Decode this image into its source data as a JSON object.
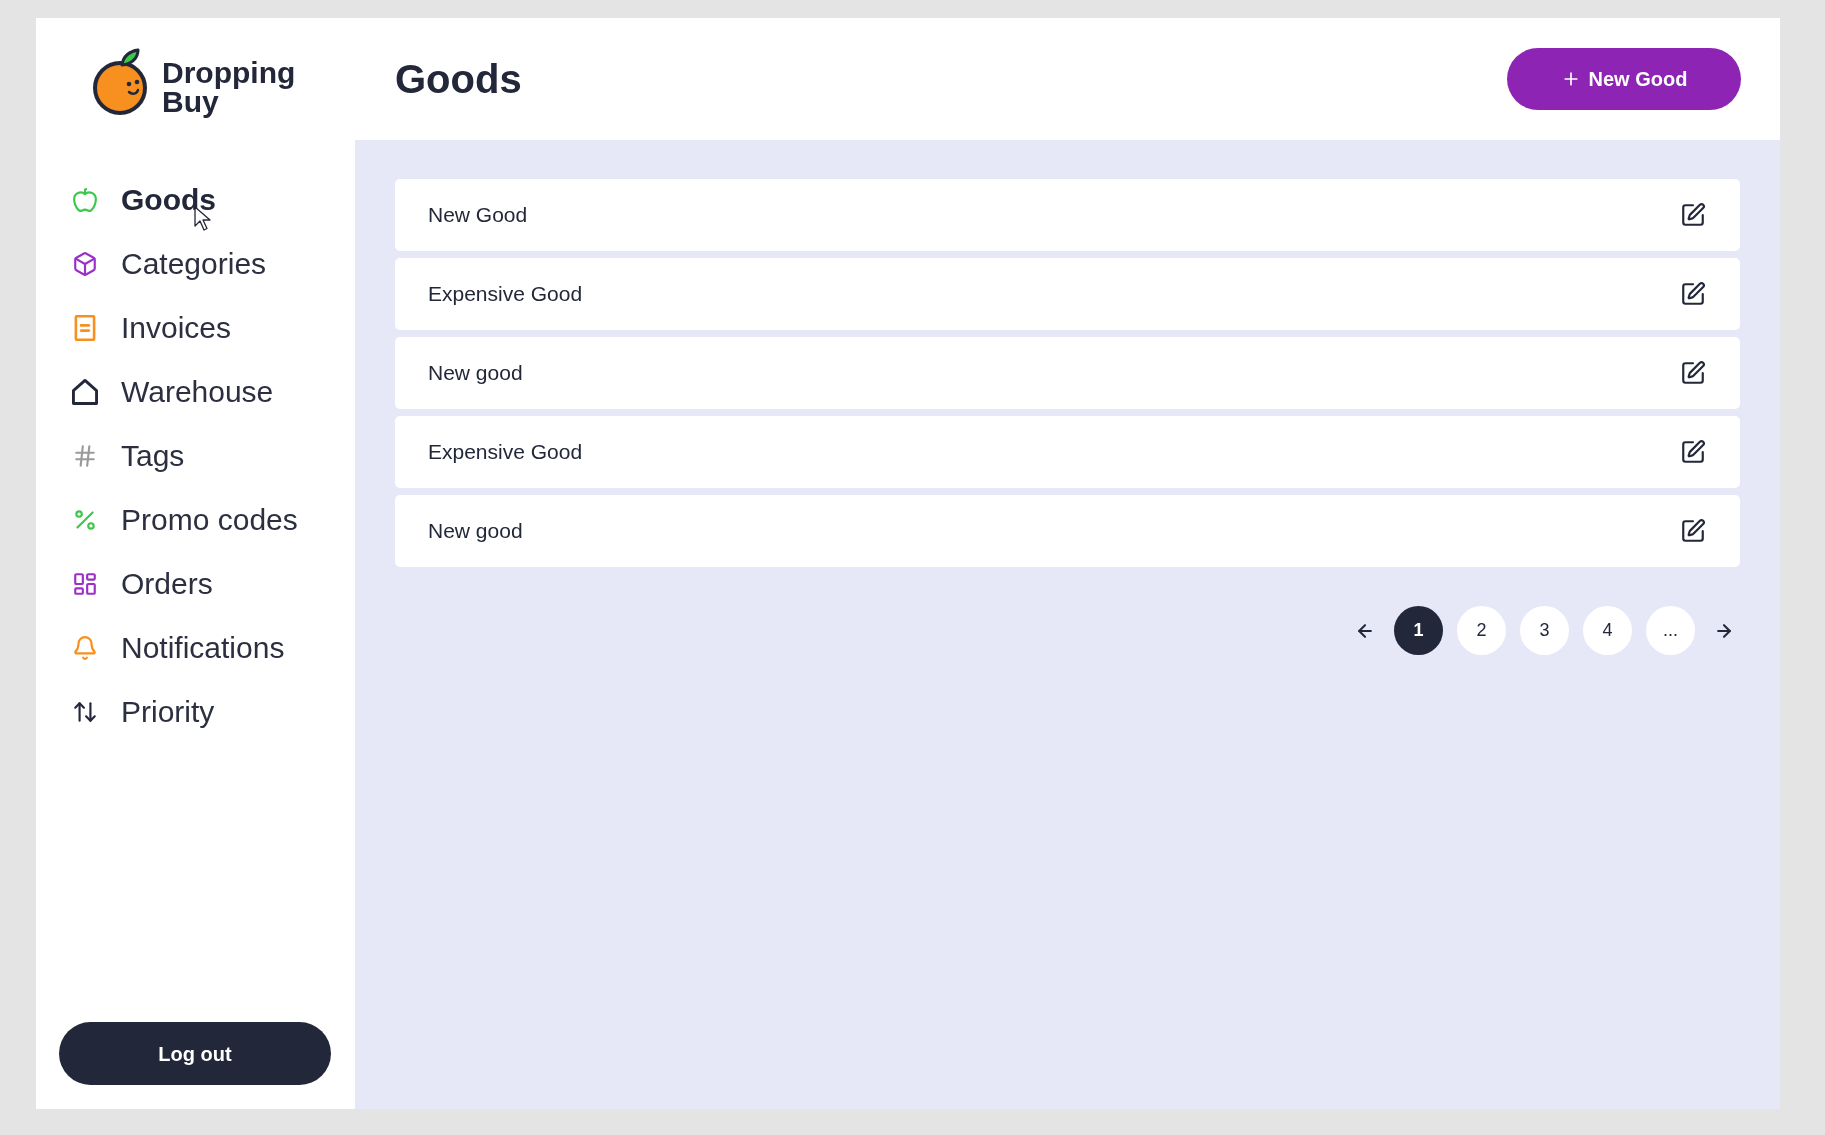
{
  "sidebar": {
    "logo": {
      "lines": [
        "Dropping",
        "Buy"
      ]
    },
    "items": [
      {
        "label": "Goods",
        "selected": true,
        "color": "#3cc84a"
      },
      {
        "label": "Categories",
        "selected": false,
        "color": "#9b30c8"
      },
      {
        "label": "Invoices",
        "selected": false,
        "color": "#f7901e"
      },
      {
        "label": "Warehouse",
        "selected": false,
        "color": "#23273a"
      },
      {
        "label": "Tags",
        "selected": false,
        "color": "#9a9a9a"
      },
      {
        "label": "Promo codes",
        "selected": false,
        "color": "#3cc84a"
      },
      {
        "label": "Orders",
        "selected": false,
        "color": "#9b30c8"
      },
      {
        "label": "Notifications",
        "selected": false,
        "color": "#f7901e"
      },
      {
        "label": "Priority",
        "selected": false,
        "color": "#23273a"
      }
    ],
    "logout_button": "Log out"
  },
  "header": {
    "title": "Goods",
    "new_button": "New Good"
  },
  "goods_list": [
    {
      "name": "New Good"
    },
    {
      "name": "Expensive Good"
    },
    {
      "name": "New good"
    },
    {
      "name": "Expensive Good"
    },
    {
      "name": "New good"
    }
  ],
  "pagination": {
    "pages": [
      {
        "label": "1",
        "selected": true
      },
      {
        "label": "2",
        "selected": false
      },
      {
        "label": "3",
        "selected": false
      },
      {
        "label": "4",
        "selected": false
      },
      {
        "label": "...",
        "selected": false
      }
    ]
  }
}
